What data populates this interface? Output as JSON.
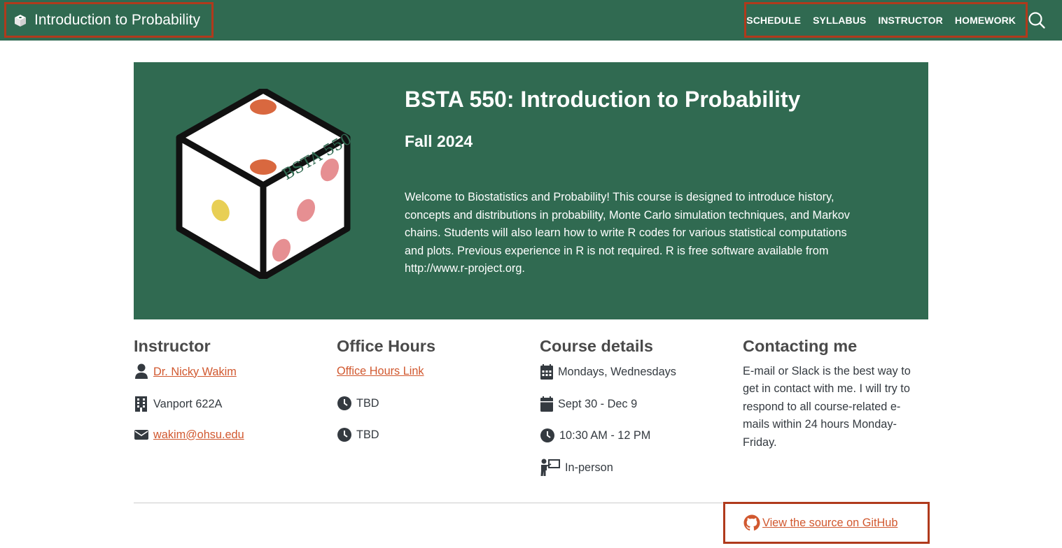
{
  "navbar": {
    "brand_title": "Introduction to Probability",
    "links": [
      "SCHEDULE",
      "SYLLABUS",
      "INSTRUCTOR",
      "HOMEWORK"
    ],
    "search_icon": "search-icon",
    "accent": "#306a51",
    "highlight_border": "#b03a1c"
  },
  "hero": {
    "dice_label": "BSTA 550",
    "title": "BSTA 550: Introduction to Probability",
    "subtitle": "Fall 2024",
    "description": "Welcome to Biostatistics and Probability! This course is designed to introduce history, concepts and distributions in probability, Monte Carlo simulation techniques, and Markov chains. Students will also learn how to write R codes for various statistical computations and plots. Previous experience in R is not required. R is free software available from http://www.r-project.org."
  },
  "instructor": {
    "heading": "Instructor",
    "name": "Dr. Nicky Wakim",
    "office": "Vanport 622A",
    "email": "wakim@ohsu.edu"
  },
  "office_hours": {
    "heading": "Office Hours",
    "link_label": "Office Hours Link",
    "slot1": "TBD",
    "slot2": "TBD"
  },
  "course_details": {
    "heading": "Course details",
    "days": "Mondays, Wednesdays",
    "dates": "Sept 30 - Dec 9",
    "time": "10:30 AM - 12 PM",
    "mode": "In-person"
  },
  "contact": {
    "heading": "Contacting me",
    "text": "E-mail or Slack is the best way to get in contact with me. I will try to respond to all course-related e-mails within 24 hours Monday-Friday."
  },
  "footer": {
    "github_label": "View the source on GitHub",
    "link_color": "#d1582f"
  }
}
